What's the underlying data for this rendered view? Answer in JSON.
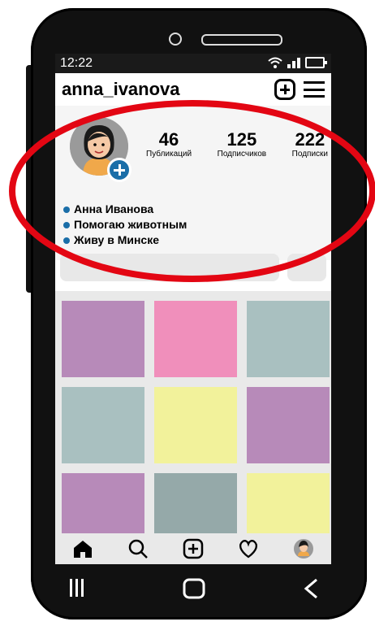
{
  "status": {
    "time": "12:22"
  },
  "header": {
    "username": "anna_ivanova"
  },
  "profile": {
    "stats": [
      {
        "num": "46",
        "label": "Публикаций"
      },
      {
        "num": "125",
        "label": "Подписчиков"
      },
      {
        "num": "222",
        "label": "Подписки"
      }
    ],
    "bio": [
      "Анна Иванова",
      "Помогаю животным",
      "Живу в Минске"
    ]
  },
  "colors": {
    "accent": "#1a6ea8",
    "highlight": "#e30613",
    "tiles": [
      "#b78ab9",
      "#f08fbb",
      "#a9c0c0",
      "#a9c0c0",
      "#f2f29b",
      "#b78ab9",
      "#b78ab9",
      "#95a9a9",
      "#f2f29b"
    ]
  }
}
